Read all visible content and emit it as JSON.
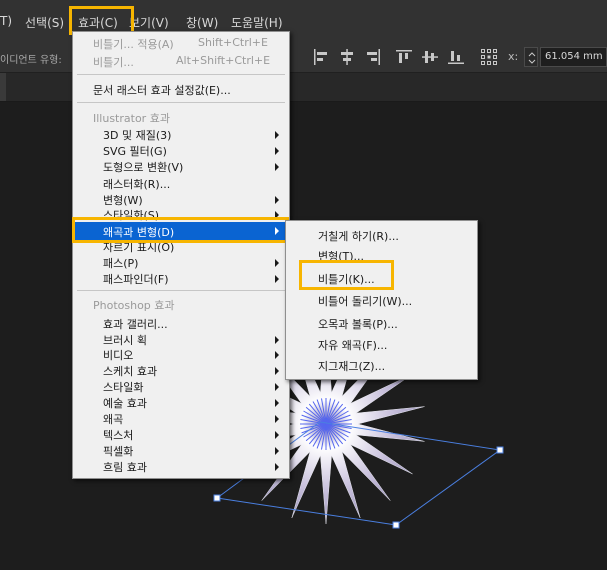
{
  "menubar": {
    "items": [
      "T)",
      "선택(S)",
      "효과(C)",
      "보기(V)",
      "창(W)",
      "도움말(H)"
    ]
  },
  "optionsbar": {
    "label": "이디언트 유형:",
    "x_label": "x:",
    "x_value": "61.054 mm"
  },
  "effect_menu": {
    "top": [
      {
        "label": "비틀기... 적용(A)",
        "shortcut": "Shift+Ctrl+E"
      },
      {
        "label": "비틀기...",
        "shortcut": "Alt+Shift+Ctrl+E"
      }
    ],
    "doc_raster": "문서 래스터 효과 설정값(E)...",
    "illustrator_header": "Illustrator 효과",
    "illustrator_items": [
      "3D 및 재질(3)",
      "SVG 필터(G)",
      "도형으로 변환(V)",
      "래스터화(R)...",
      "변형(W)",
      "스타일화(S)",
      "왜곡과 변형(D)",
      "자르기 표시(O)",
      "패스(P)",
      "패스파인더(F)"
    ],
    "photoshop_header": "Photoshop 효과",
    "photoshop_items": [
      "효과 갤러리...",
      "브러시 획",
      "비디오",
      "스케치 효과",
      "스타일화",
      "예술 효과",
      "왜곡",
      "텍스처",
      "픽셀화",
      "흐림 효과"
    ]
  },
  "distort_submenu": {
    "items": [
      "거칠게 하기(R)...",
      "변형(T)...",
      "비틀기(K)...",
      "비틀어 돌리기(W)...",
      "오목과 볼록(P)...",
      "자유 왜곡(F)...",
      "지그재그(Z)..."
    ]
  },
  "colors": {
    "highlight_border": "#f7b500",
    "menu_selection": "#0a64d2",
    "selection_box": "#4a7fe0",
    "star_fill": "#c8c0dc"
  }
}
